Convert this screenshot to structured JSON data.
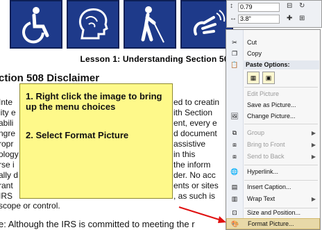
{
  "document": {
    "title": "Lesson 1: Understanding Section 508",
    "heading": "ction 508 Disclaimer",
    "body_fragments": [
      "Inte",
      "lity e",
      "abili",
      "ngre",
      "ropr",
      "ology",
      "rse i",
      "ally d",
      "rant",
      "IRS",
      "scope or control."
    ],
    "right_fragments": [
      "ed to creatin",
      "ith Section",
      "ent, every e",
      "d document",
      "assistive",
      "in this",
      "the inform",
      "der. No acc",
      "ents or sites",
      ", as such is"
    ],
    "footer_text": "e: Although the IRS is committed to meeting the r",
    "icons": [
      "wheelchair-icon",
      "head-icon",
      "blind-cane-icon",
      "sign-language-icon"
    ]
  },
  "instructions": {
    "step1": "1. Right click the image to bring up the menu choices",
    "step2": "2. Select Format Picture"
  },
  "toolbar": {
    "height_value": "0.79",
    "width_value": "3.8\""
  },
  "context_menu": {
    "cut": "Cut",
    "copy": "Copy",
    "paste_options": "Paste Options:",
    "edit_picture": "Edit Picture",
    "save_as_picture": "Save as Picture...",
    "change_picture": "Change Picture...",
    "group": "Group",
    "bring_to_front": "Bring to Front",
    "send_to_back": "Send to Back",
    "hyperlink": "Hyperlink...",
    "insert_caption": "Insert Caption...",
    "wrap_text": "Wrap Text",
    "size_and_position": "Size and Position...",
    "format_picture": "Format Picture..."
  },
  "colors": {
    "icon_bg": "#1e3a8a",
    "note_bg": "#fef98a",
    "menu_highlight": "#e8d9a8",
    "arrow": "#e01010"
  }
}
